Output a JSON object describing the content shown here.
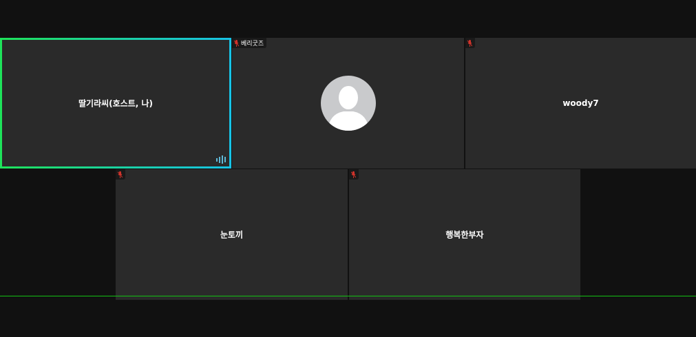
{
  "participants": [
    {
      "name": "딸기라씨(호스트, 나)",
      "muted": false,
      "speaking": true
    },
    {
      "name": "베리굿즈",
      "muted": true,
      "has_avatar": true
    },
    {
      "name": "woody7",
      "muted": true
    },
    {
      "name": "눈토끼",
      "muted": true
    },
    {
      "name": "행복한부자",
      "muted": true
    }
  ],
  "colors": {
    "active_border_start": "#1ee35a",
    "active_border_end": "#17c3e6",
    "muted_icon": "#d0332b"
  }
}
